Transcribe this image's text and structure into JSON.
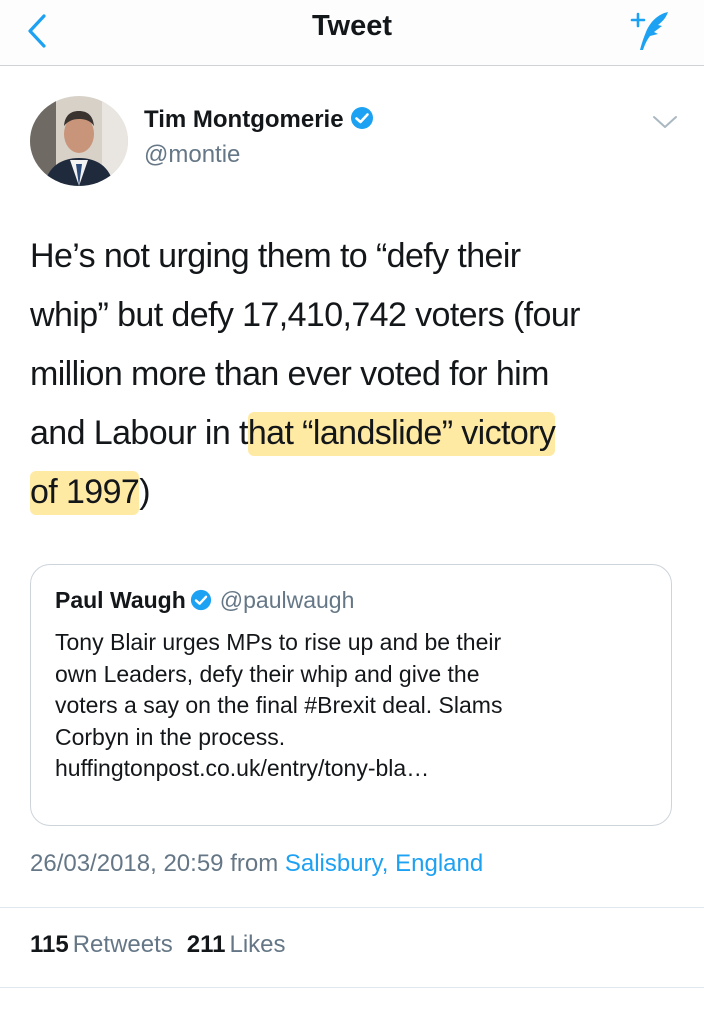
{
  "nav": {
    "title": "Tweet"
  },
  "author": {
    "name": "Tim Montgomerie",
    "handle": "@montie",
    "verified": true,
    "avatar_icon": "profile-photo"
  },
  "tweet": {
    "lines": [
      "He’s not urging them to “defy their",
      "whip” but defy 17,410,742 voters (four",
      "million more than ever voted for him"
    ],
    "line4_plain": "and Labour in t",
    "line4_highlight": "hat “landslide” victory",
    "line5_highlight": "of 1997",
    "line5_plain": ")"
  },
  "quote": {
    "name": "Paul Waugh",
    "handle": "@paulwaugh",
    "verified": true,
    "lines": [
      "Tony Blair urges MPs to rise up and be their",
      "own Leaders, defy their whip and give the",
      "voters a say on the final #Brexit deal. Slams",
      "Corbyn in the process.",
      "huffingtonpost.co.uk/entry/tony-bla…"
    ]
  },
  "meta": {
    "datetime": "26/03/2018, 20:59",
    "from_label": "from",
    "location": "Salisbury, England"
  },
  "stats": {
    "retweets_count": "115",
    "retweets_label": "Retweets",
    "likes_count": "211",
    "likes_label": "Likes"
  },
  "colors": {
    "accent": "#1da1f2",
    "muted": "#657786",
    "highlight": "#ffd750"
  }
}
